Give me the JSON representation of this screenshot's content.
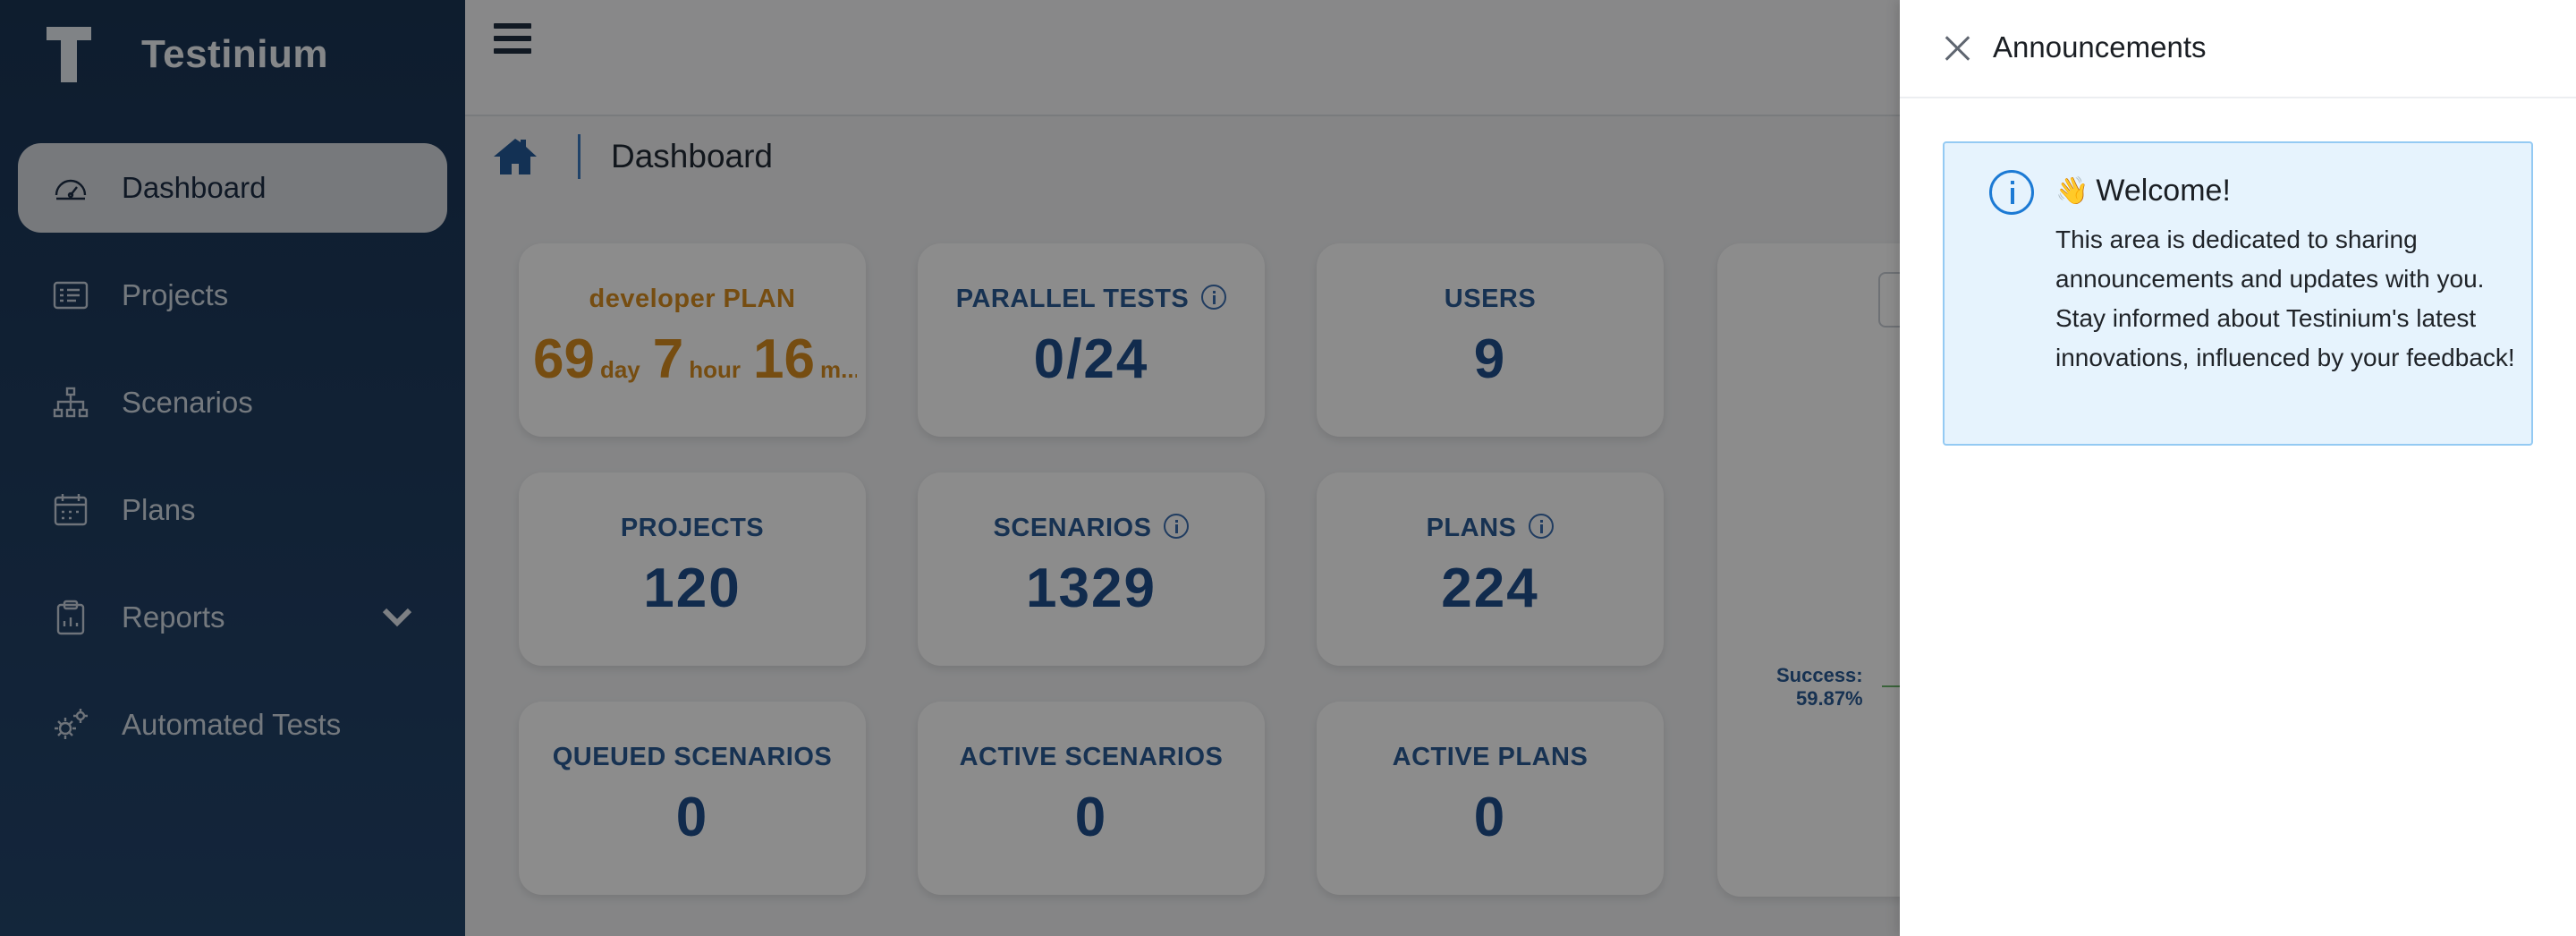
{
  "sidebar": {
    "brand_name": "Testinium",
    "items": [
      {
        "label": "Dashboard",
        "icon": "speedometer-icon",
        "active": true
      },
      {
        "label": "Projects",
        "icon": "projects-icon"
      },
      {
        "label": "Scenarios",
        "icon": "sitemap-icon"
      },
      {
        "label": "Plans",
        "icon": "calendar-icon"
      },
      {
        "label": "Reports",
        "icon": "clipboard-icon",
        "expandable": true
      },
      {
        "label": "Automated Tests",
        "icon": "gears-icon"
      }
    ]
  },
  "breadcrumb": {
    "title": "Dashboard"
  },
  "stats": {
    "plan": {
      "label": "developer PLAN",
      "days": "69",
      "day_unit": "day",
      "hours": "7",
      "hour_unit": "hour",
      "minutes": "16",
      "minute_unit": "m..."
    },
    "parallel_tests": {
      "label": "PARALLEL TESTS",
      "value": "0/24"
    },
    "users": {
      "label": "USERS",
      "value": "9"
    },
    "projects": {
      "label": "PROJECTS",
      "value": "120"
    },
    "scenarios": {
      "label": "SCENARIOS",
      "value": "1329"
    },
    "plans": {
      "label": "PLANS",
      "value": "224"
    },
    "queued_scenarios": {
      "label": "QUEUED SCENARIOS",
      "value": "0"
    },
    "active_scenarios": {
      "label": "ACTIVE SCENARIOS",
      "value": "0"
    },
    "active_plans": {
      "label": "ACTIVE PLANS",
      "value": "0"
    }
  },
  "chart": {
    "success_label": "Success:",
    "success_value": "59.87%"
  },
  "announcements": {
    "title": "Announcements",
    "heading": "Welcome!",
    "wave": "👋",
    "body": "This area is dedicated to sharing announcements and updates with you. Stay informed about Testinium's latest innovations, influenced by your feedback!"
  },
  "colors": {
    "sidebar": "#1b3555",
    "accent": "#1f4f8c",
    "plan": "#d88d20",
    "alert_bg": "#e6f3fd"
  }
}
